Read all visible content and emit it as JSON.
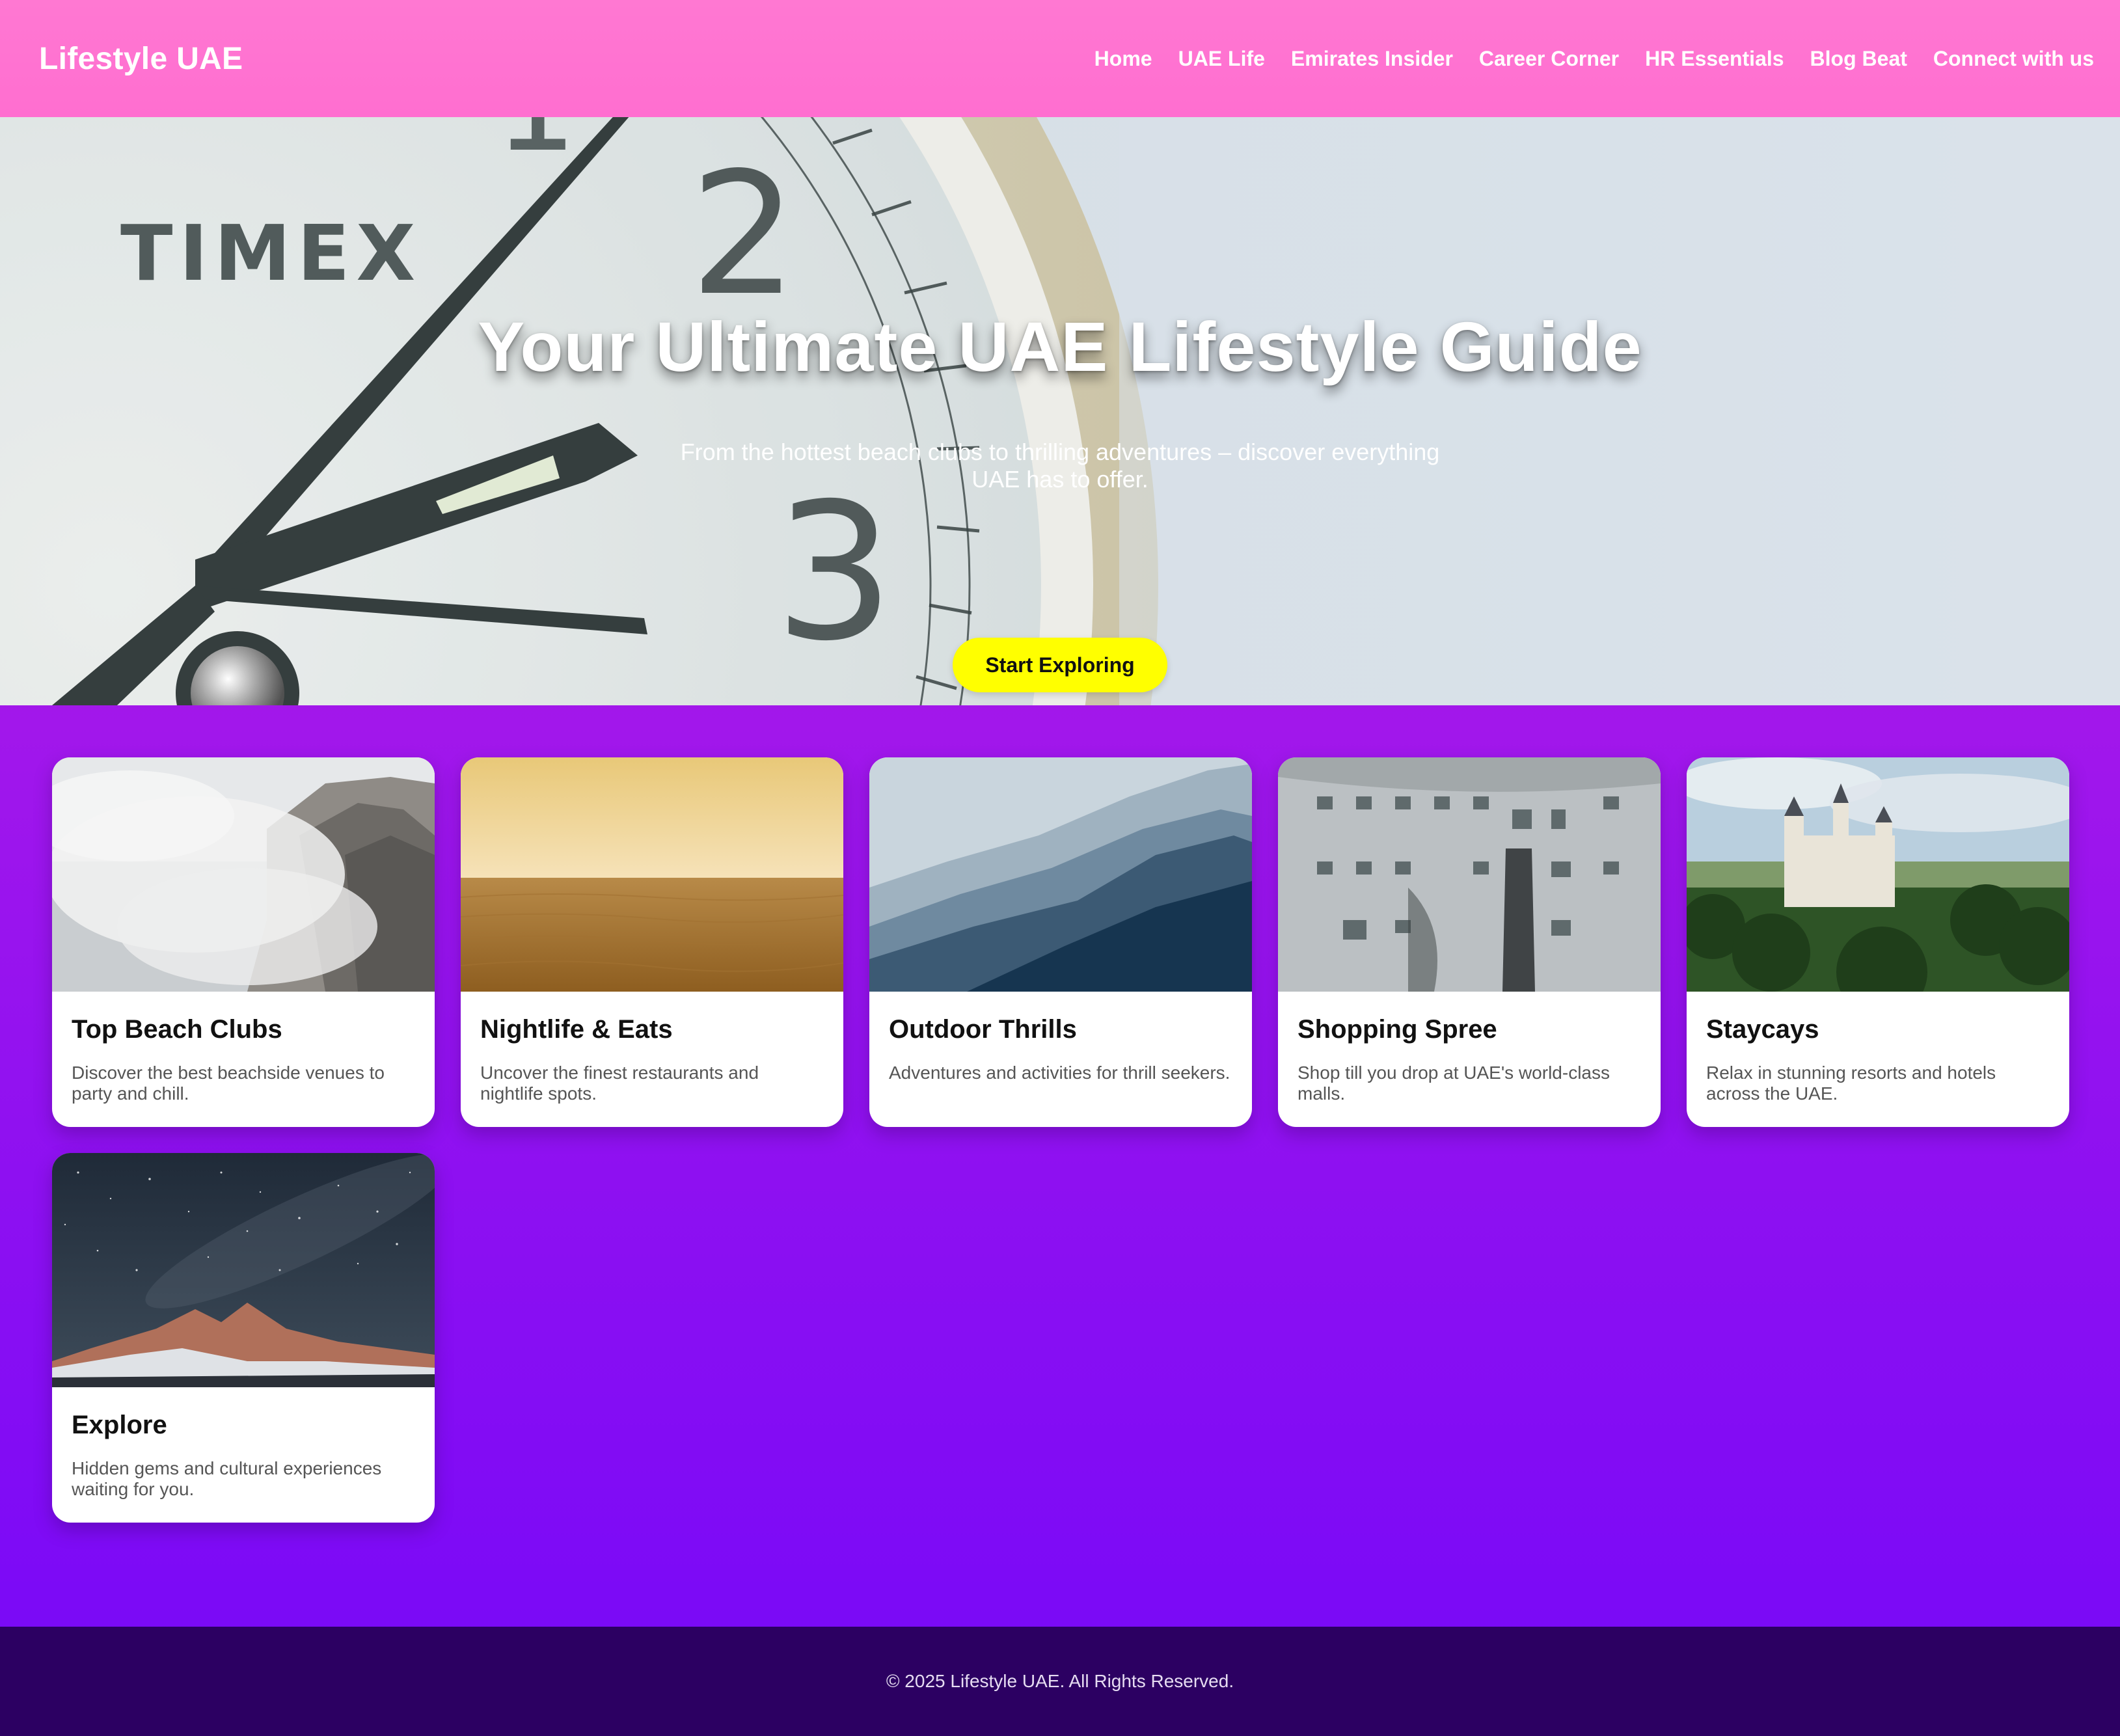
{
  "header": {
    "brand": "Lifestyle UAE",
    "nav": [
      {
        "label": "Home"
      },
      {
        "label": "UAE Life"
      },
      {
        "label": "Emirates Insider"
      },
      {
        "label": "Career Corner"
      },
      {
        "label": "HR Essentials"
      },
      {
        "label": "Blog Beat"
      },
      {
        "label": "Connect with us"
      }
    ]
  },
  "hero": {
    "title": "Your Ultimate UAE Lifestyle Guide",
    "subtitle": "From the hottest beach clubs to thrilling adventures – discover everything UAE has to offer.",
    "cta": "Start Exploring",
    "background_brand_text": "TIMEX",
    "cta_color": "#ffff00"
  },
  "cards": [
    {
      "title": "Top Beach Clubs",
      "text": "Discover the best beachside venues to party and chill.",
      "image": "misty-cliff-photo"
    },
    {
      "title": "Nightlife & Eats",
      "text": "Uncover the finest restaurants and nightlife spots.",
      "image": "desert-dunes-photo"
    },
    {
      "title": "Outdoor Thrills",
      "text": "Adventures and activities for thrill seekers.",
      "image": "mountain-ridges-photo"
    },
    {
      "title": "Shopping Spree",
      "text": "Shop till you drop at UAE's world-class malls.",
      "image": "weathered-building-photo"
    },
    {
      "title": "Staycays",
      "text": "Relax in stunning resorts and hotels across the UAE.",
      "image": "castle-landscape-photo"
    },
    {
      "title": "Explore",
      "text": "Hidden gems and cultural experiences waiting for you.",
      "image": "starry-night-photo"
    }
  ],
  "footer": {
    "text": "© 2025 Lifestyle UAE. All Rights Reserved."
  },
  "colors": {
    "header": "#ff6ed0",
    "page_gradient_top": "#c424dc",
    "page_gradient_bottom": "#7608f8",
    "footer": "#2c0062"
  }
}
